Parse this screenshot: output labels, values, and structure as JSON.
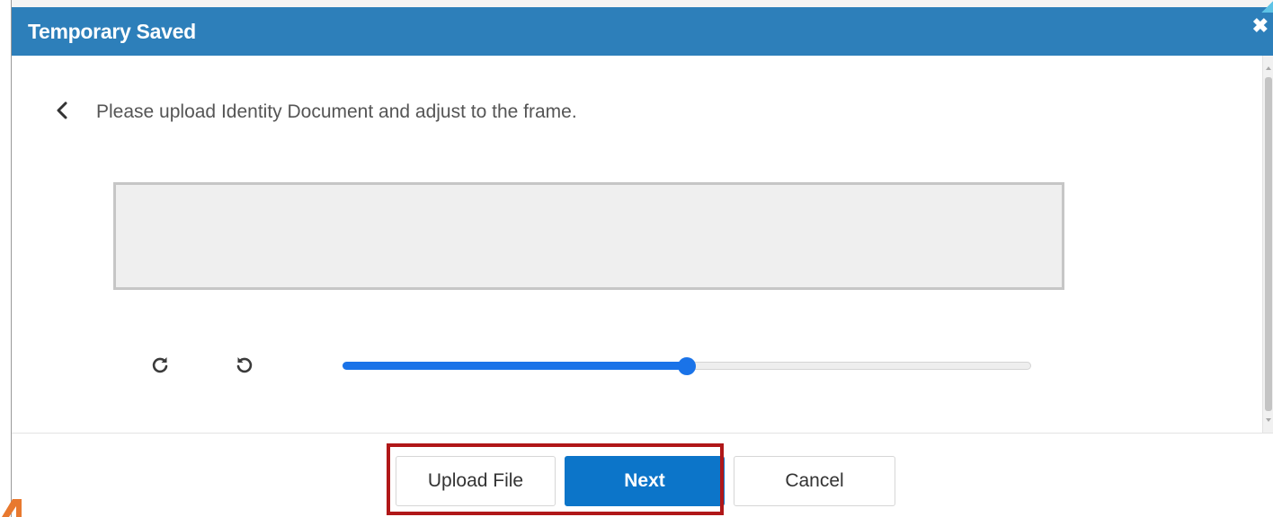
{
  "dialog": {
    "title": "Temporary Saved",
    "close_icon": "close-icon",
    "instruction": "Please upload Identity Document and adjust to the frame.",
    "back_icon": "chevron-left-icon",
    "rotate_right_icon": "rotate-clockwise-icon",
    "rotate_left_icon": "rotate-counterclockwise-icon",
    "zoom_slider": {
      "value": 0.5
    },
    "buttons": {
      "upload": "Upload File",
      "next": "Next",
      "cancel": "Cancel"
    }
  },
  "colors": {
    "header": "#2d7fba",
    "primary": "#0c75c9",
    "slider": "#1a73e8",
    "highlight": "#b01718"
  }
}
